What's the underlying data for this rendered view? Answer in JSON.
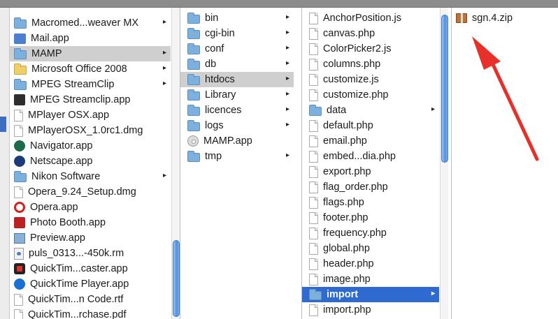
{
  "columns": {
    "col1": [
      {
        "label": "Macromed...weaver MX",
        "icon": "folder-icon",
        "chevron": true
      },
      {
        "label": "Mail.app",
        "icon": "mail-icon",
        "chevron": false
      },
      {
        "label": "MAMP",
        "icon": "folder-icon",
        "chevron": true,
        "selected": "gray"
      },
      {
        "label": "Microsoft Office 2008",
        "icon": "folder-yellow-icon",
        "chevron": true
      },
      {
        "label": "MPEG StreamClip",
        "icon": "folder-icon",
        "chevron": true
      },
      {
        "label": "MPEG Streamclip.app",
        "icon": "streamclip-icon",
        "chevron": false
      },
      {
        "label": "MPlayer OSX.app",
        "icon": "mplayer-icon",
        "chevron": false
      },
      {
        "label": "MPlayerOSX_1.0rc1.dmg",
        "icon": "document-icon",
        "chevron": false
      },
      {
        "label": "Navigator.app",
        "icon": "navigator-icon",
        "chevron": false
      },
      {
        "label": "Netscape.app",
        "icon": "netscape-icon",
        "chevron": false
      },
      {
        "label": "Nikon Software",
        "icon": "folder-icon",
        "chevron": true
      },
      {
        "label": "Opera_9.24_Setup.dmg",
        "icon": "document-icon",
        "chevron": false
      },
      {
        "label": "Opera.app",
        "icon": "opera-icon",
        "chevron": false
      },
      {
        "label": "Photo Booth.app",
        "icon": "photo-booth-icon",
        "chevron": false
      },
      {
        "label": "Preview.app",
        "icon": "preview-icon",
        "chevron": false
      },
      {
        "label": "puls_0313...-450k.rm",
        "icon": "movie-file-icon",
        "chevron": false
      },
      {
        "label": "QuickTim...caster.app",
        "icon": "quicktime-broadcaster-icon",
        "chevron": false
      },
      {
        "label": "QuickTime Player.app",
        "icon": "quicktime-icon",
        "chevron": false
      },
      {
        "label": "QuickTim...n Code.rtf",
        "icon": "document-icon",
        "chevron": false
      },
      {
        "label": "QuickTim...rchase.pdf",
        "icon": "document-icon",
        "chevron": false
      }
    ],
    "col2": [
      {
        "label": "bin",
        "icon": "folder-icon",
        "chevron": true
      },
      {
        "label": "cgi-bin",
        "icon": "folder-icon",
        "chevron": true
      },
      {
        "label": "conf",
        "icon": "folder-icon",
        "chevron": true
      },
      {
        "label": "db",
        "icon": "folder-icon",
        "chevron": true
      },
      {
        "label": "htdocs",
        "icon": "folder-icon",
        "chevron": true,
        "selected": "gray"
      },
      {
        "label": "Library",
        "icon": "folder-icon",
        "chevron": true
      },
      {
        "label": "licences",
        "icon": "folder-icon",
        "chevron": true
      },
      {
        "label": "logs",
        "icon": "folder-icon",
        "chevron": true
      },
      {
        "label": "MAMP.app",
        "icon": "mamp-app-icon",
        "chevron": false
      },
      {
        "label": "tmp",
        "icon": "folder-icon",
        "chevron": true
      }
    ],
    "col3": [
      {
        "label": "AnchorPosition.js",
        "icon": "document-icon",
        "chevron": false
      },
      {
        "label": "canvas.php",
        "icon": "document-icon",
        "chevron": false
      },
      {
        "label": "ColorPicker2.js",
        "icon": "document-icon",
        "chevron": false
      },
      {
        "label": "columns.php",
        "icon": "document-icon",
        "chevron": false
      },
      {
        "label": "customize.js",
        "icon": "document-icon",
        "chevron": false
      },
      {
        "label": "customize.php",
        "icon": "document-icon",
        "chevron": false
      },
      {
        "label": "data",
        "icon": "folder-icon",
        "chevron": true
      },
      {
        "label": "default.php",
        "icon": "document-icon",
        "chevron": false
      },
      {
        "label": "email.php",
        "icon": "document-icon",
        "chevron": false
      },
      {
        "label": "embed...dia.php",
        "icon": "document-icon",
        "chevron": false
      },
      {
        "label": "export.php",
        "icon": "document-icon",
        "chevron": false
      },
      {
        "label": "flag_order.php",
        "icon": "document-icon",
        "chevron": false
      },
      {
        "label": "flags.php",
        "icon": "document-icon",
        "chevron": false
      },
      {
        "label": "footer.php",
        "icon": "document-icon",
        "chevron": false
      },
      {
        "label": "frequency.php",
        "icon": "document-icon",
        "chevron": false
      },
      {
        "label": "global.php",
        "icon": "document-icon",
        "chevron": false
      },
      {
        "label": "header.php",
        "icon": "document-icon",
        "chevron": false
      },
      {
        "label": "image.php",
        "icon": "document-icon",
        "chevron": false
      },
      {
        "label": "import",
        "icon": "folder-icon",
        "chevron": true,
        "selected": "blue"
      },
      {
        "label": "import.php",
        "icon": "document-icon",
        "chevron": false
      }
    ],
    "col4": [
      {
        "label": "sgn.4.zip",
        "icon": "zip-icon",
        "chevron": false
      }
    ]
  },
  "chevron_glyph": "▸",
  "annotation": {
    "color": "#e8302a"
  },
  "accent": "#2f6ad0"
}
